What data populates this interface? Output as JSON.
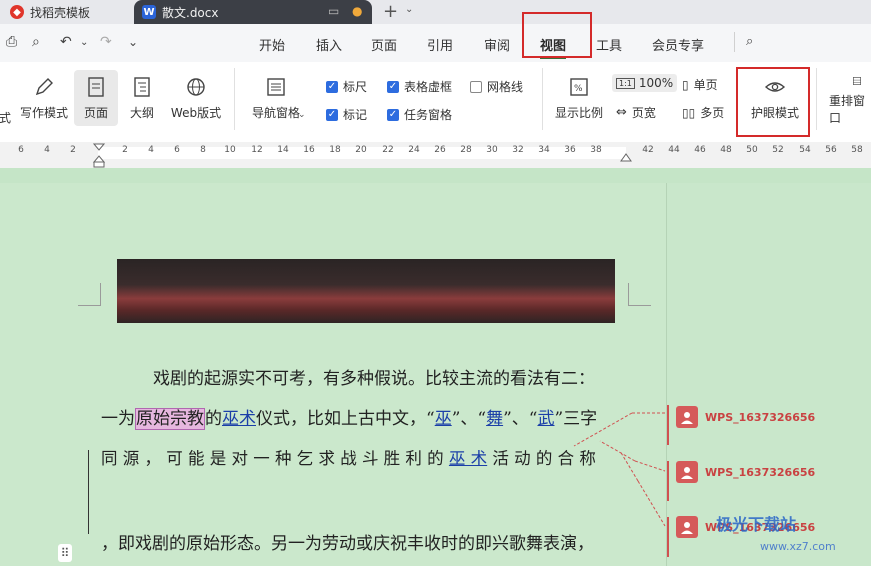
{
  "tabs": {
    "store": "找稻壳模板",
    "document": "散文.docx"
  },
  "menu": {
    "items": [
      "开始",
      "插入",
      "页面",
      "引用",
      "审阅",
      "视图",
      "工具",
      "会员专享"
    ],
    "active": "视图"
  },
  "ribbon": {
    "partial": "式",
    "write_mode": "写作模式",
    "page_view": "页面",
    "outline": "大纲",
    "web_view": "Web版式",
    "nav_pane": "导航窗格",
    "checkboxes": [
      {
        "label": "标尺",
        "checked": true
      },
      {
        "label": "表格虚框",
        "checked": true
      },
      {
        "label": "网格线",
        "checked": false
      },
      {
        "label": "标记",
        "checked": true
      },
      {
        "label": "任务窗格",
        "checked": true
      }
    ],
    "zoom_label": "显示比例",
    "zoom_value": "100%",
    "page_width": "页宽",
    "single_page": "单页",
    "multi_page": "多页",
    "eye_mode": "护眼模式",
    "rearrange": "重排窗口"
  },
  "ruler": [
    "6",
    "4",
    "2",
    "2",
    "4",
    "6",
    "8",
    "10",
    "12",
    "14",
    "16",
    "18",
    "20",
    "22",
    "24",
    "26",
    "28",
    "30",
    "32",
    "34",
    "36",
    "38",
    "42",
    "44",
    "46",
    "48",
    "50",
    "52",
    "54",
    "56",
    "58"
  ],
  "document": {
    "line1": "戏剧的起源实不可考，有多种假说。比较主流的看法有二：",
    "line2_a": "一为",
    "line2_highlight": "原始宗教",
    "line2_b": "的",
    "line2_link1": "巫术",
    "line2_c": "仪式，比如上古中文，“",
    "line2_link2": "巫",
    "line2_d": "”、“",
    "line2_link3": "舞",
    "line2_e": "”、“",
    "line2_link4": "武",
    "line2_f": "”三字",
    "line3_a": "同 源 ， 可 能 是 对 一 种 乞 求 战 斗 胜 利 的 ",
    "line3_link": "巫 术",
    "line3_b": " 活 动 的 合 称",
    "line4": "，即戏剧的原始形态。另一为劳动或庆祝丰收时的即兴歌舞表演，"
  },
  "comments": [
    {
      "author": "WPS_1637326656"
    },
    {
      "author": "WPS_1637326656"
    },
    {
      "author": "WPS_1637326656"
    }
  ],
  "watermark": {
    "title": "极光下载站",
    "url": "www.xz7.com"
  }
}
